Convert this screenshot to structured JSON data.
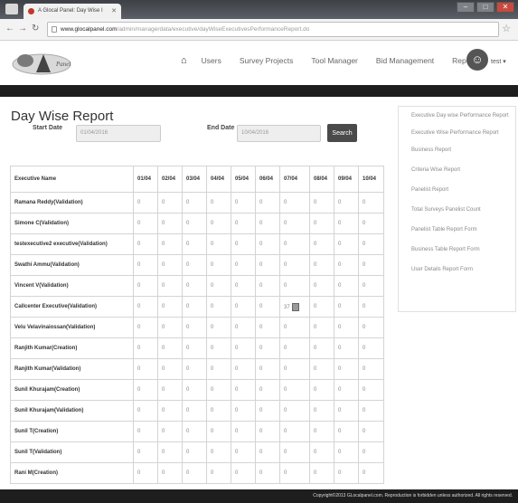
{
  "browser": {
    "tab_title": "A Glocal Panel: Day Wise I",
    "url_host": "www.glocalpanel.com",
    "url_path": "/admin/managerdata/executive/dayWiseExecutivesPerformanceReport.do"
  },
  "header": {
    "logo_text": "Glocal Panel",
    "nav": [
      "Users",
      "Survey Projects",
      "Tool Manager",
      "Bid Management",
      "Reports"
    ],
    "user_label": "test ▾"
  },
  "report": {
    "title": "Day Wise Report",
    "start_label": "Start Date",
    "start_value": "01/04/2016",
    "end_label": "End Date",
    "end_value": "10/04/2016",
    "search_label": "Search",
    "columns": [
      "Executive Name",
      "01/04",
      "02/04",
      "03/04",
      "04/04",
      "05/04",
      "06/04",
      "07/04",
      "08/04",
      "09/04",
      "10/04"
    ],
    "rows": [
      {
        "name": "Ramana Reddy(Validation)",
        "values": [
          "0",
          "0",
          "0",
          "0",
          "0",
          "0",
          "0",
          "0",
          "0",
          "0"
        ]
      },
      {
        "name": "Simone C(Validation)",
        "values": [
          "0",
          "0",
          "0",
          "0",
          "0",
          "0",
          "0",
          "0",
          "0",
          "0"
        ]
      },
      {
        "name": "testexecutive2 executive(Validation)",
        "values": [
          "0",
          "0",
          "0",
          "0",
          "0",
          "0",
          "0",
          "0",
          "0",
          "0"
        ]
      },
      {
        "name": "Swathi Ammu(Validation)",
        "values": [
          "0",
          "0",
          "0",
          "0",
          "0",
          "0",
          "0",
          "0",
          "0",
          "0"
        ]
      },
      {
        "name": "Vincent V(Validation)",
        "values": [
          "0",
          "0",
          "0",
          "0",
          "0",
          "0",
          "0",
          "0",
          "0",
          "0"
        ]
      },
      {
        "name": "Callcenter Executive(Validation)",
        "values": [
          "0",
          "0",
          "0",
          "0",
          "0",
          "0",
          "37",
          "0",
          "0",
          "0"
        ]
      },
      {
        "name": "Velu Velavinaiossan(Validation)",
        "values": [
          "0",
          "0",
          "0",
          "0",
          "0",
          "0",
          "0",
          "0",
          "0",
          "0"
        ]
      },
      {
        "name": "Ranjith Kumar(Creation)",
        "values": [
          "0",
          "0",
          "0",
          "0",
          "0",
          "0",
          "0",
          "0",
          "0",
          "0"
        ]
      },
      {
        "name": "Ranjith Kumar(Validation)",
        "values": [
          "0",
          "0",
          "0",
          "0",
          "0",
          "0",
          "0",
          "0",
          "0",
          "0"
        ]
      },
      {
        "name": "Sunil Khurajam(Creation)",
        "values": [
          "0",
          "0",
          "0",
          "0",
          "0",
          "0",
          "0",
          "0",
          "0",
          "0"
        ]
      },
      {
        "name": "Sunil Khurajam(Validation)",
        "values": [
          "0",
          "0",
          "0",
          "0",
          "0",
          "0",
          "0",
          "0",
          "0",
          "0"
        ]
      },
      {
        "name": "Sunil T(Creation)",
        "values": [
          "0",
          "0",
          "0",
          "0",
          "0",
          "0",
          "0",
          "0",
          "0",
          "0"
        ]
      },
      {
        "name": "Sunil T(Validation)",
        "values": [
          "0",
          "0",
          "0",
          "0",
          "0",
          "0",
          "0",
          "0",
          "0",
          "0"
        ]
      },
      {
        "name": "Rani M(Creation)",
        "values": [
          "0",
          "0",
          "0",
          "0",
          "0",
          "0",
          "0",
          "0",
          "0",
          "0"
        ]
      }
    ]
  },
  "sidebar": {
    "items": [
      "Executive Day wise Performance Report",
      "Executive Wise Performance Report",
      "Business Report",
      "Criteria Wise Report",
      "Panelist Report",
      "Total Surveys Panelist Count",
      "Panelist Table Report Form",
      "Business Table Report Form",
      "User Details Report Form"
    ]
  },
  "footer": {
    "text": "Copyright©2013 GLocalpanel.com. Reproduction is forbidden unless authorized. All rights reserved."
  },
  "icons": [
    "home-icon",
    "star-icon",
    "lock-icon",
    "calendar-icon",
    "user-avatar-icon"
  ]
}
